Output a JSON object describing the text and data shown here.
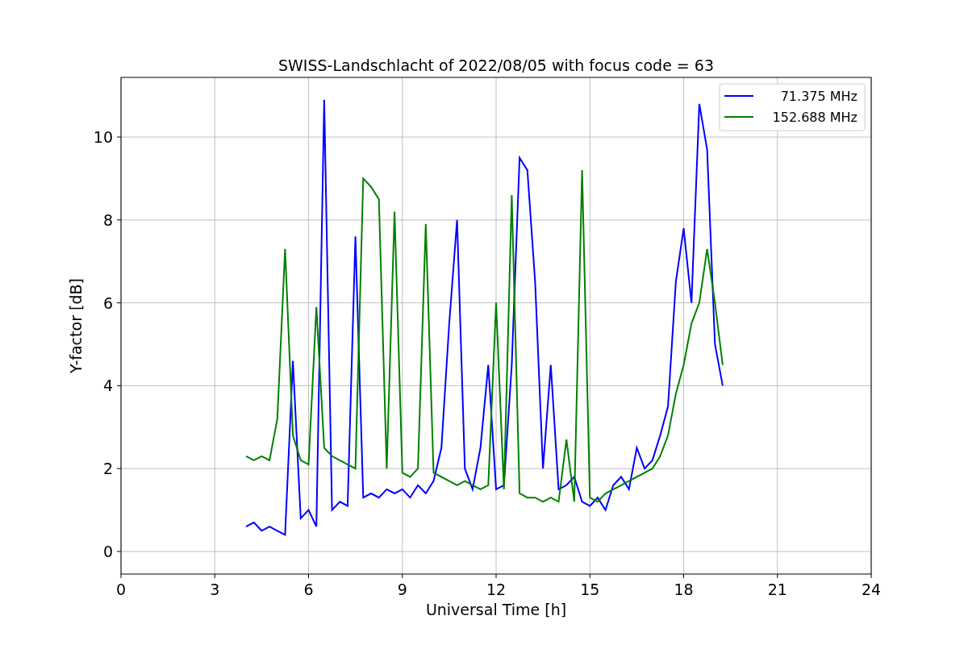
{
  "figure": {
    "chart_data": {
      "type": "line",
      "title": "SWISS-Landschlacht of 2022/08/05 with focus code = 63",
      "xlabel": "Universal Time [h]",
      "ylabel": "Y-factor [dB]",
      "x": [
        4,
        4.25,
        4.5,
        4.75,
        5,
        5.25,
        5.5,
        5.75,
        6,
        6.25,
        6.5,
        6.75,
        7,
        7.25,
        7.5,
        7.75,
        8,
        8.25,
        8.5,
        8.75,
        9,
        9.25,
        9.5,
        9.75,
        10,
        10.25,
        10.5,
        10.75,
        11,
        11.25,
        11.5,
        11.75,
        12,
        12.25,
        12.5,
        12.75,
        13,
        13.25,
        13.5,
        13.75,
        14,
        14.25,
        14.5,
        14.75,
        15,
        15.25,
        15.5,
        15.75,
        16,
        16.25,
        16.5,
        16.75,
        17,
        17.25,
        17.5,
        17.75,
        18,
        18.25,
        18.5,
        18.75,
        19,
        19.25
      ],
      "series": [
        {
          "name": "71.375 MHz",
          "color": "#0000ff",
          "values": [
            0.6,
            0.7,
            0.5,
            0.6,
            0.5,
            0.4,
            4.6,
            0.8,
            1.0,
            0.6,
            10.9,
            1.0,
            1.2,
            1.1,
            7.6,
            1.3,
            1.4,
            1.3,
            1.5,
            1.4,
            1.5,
            1.3,
            1.6,
            1.4,
            1.7,
            2.5,
            5.5,
            8.0,
            2.0,
            1.5,
            2.5,
            4.5,
            1.5,
            1.6,
            4.5,
            9.5,
            9.2,
            6.5,
            2.0,
            4.5,
            1.5,
            1.6,
            1.8,
            1.2,
            1.1,
            1.3,
            1.0,
            1.6,
            1.8,
            1.5,
            2.5,
            2.0,
            2.2,
            2.8,
            3.5,
            6.5,
            7.8,
            6.0,
            10.8,
            9.7,
            5.0,
            4.0
          ]
        },
        {
          "name": "152.688 MHz",
          "color": "#008000",
          "values": [
            2.3,
            2.2,
            2.3,
            2.2,
            3.2,
            7.3,
            2.8,
            2.2,
            2.1,
            5.9,
            2.5,
            2.3,
            2.2,
            2.1,
            2.0,
            9.0,
            8.8,
            8.5,
            2.0,
            8.2,
            1.9,
            1.8,
            2.0,
            7.9,
            1.9,
            1.8,
            1.7,
            1.6,
            1.7,
            1.6,
            1.5,
            1.6,
            6.0,
            1.5,
            8.6,
            1.4,
            1.3,
            1.3,
            1.2,
            1.3,
            1.2,
            2.7,
            1.2,
            9.2,
            1.3,
            1.2,
            1.4,
            1.5,
            1.6,
            1.7,
            1.8,
            1.9,
            2.0,
            2.3,
            2.8,
            3.8,
            4.5,
            5.5,
            6.0,
            7.3,
            6.0,
            4.5
          ]
        }
      ],
      "xlim": [
        0,
        24
      ],
      "ylim": [
        -0.545,
        11.44
      ],
      "xticks": [
        0,
        3,
        6,
        9,
        12,
        15,
        18,
        21,
        24
      ],
      "yticks": [
        0,
        2,
        4,
        6,
        8,
        10
      ],
      "grid": true,
      "legend": "upper right"
    }
  }
}
